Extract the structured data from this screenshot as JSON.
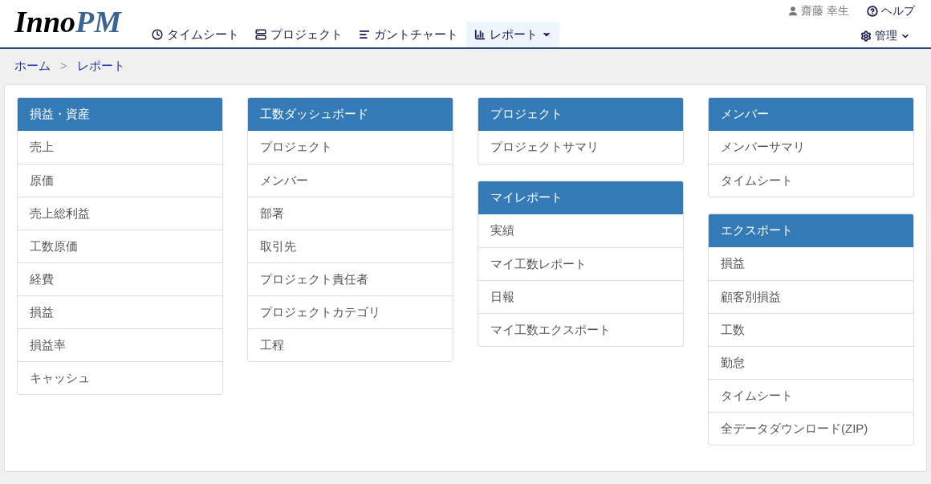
{
  "logo": {
    "first": "Inno",
    "second": "PM"
  },
  "nav": [
    {
      "label": "タイムシート",
      "kind": "link",
      "selected": false
    },
    {
      "label": "プロジェクト",
      "kind": "link",
      "selected": false
    },
    {
      "label": "ガントチャート",
      "kind": "link",
      "selected": false
    },
    {
      "label": "レポート",
      "kind": "dropdown",
      "selected": true
    }
  ],
  "user": {
    "name": "齋藤 幸生"
  },
  "help": {
    "label": "ヘルプ"
  },
  "admin": {
    "label": "管理"
  },
  "breadcrumb": [
    {
      "label": "ホーム"
    },
    {
      "label": "レポート"
    }
  ],
  "breadcrumb_separator": ">",
  "columns": [
    [
      {
        "title": "損益・資産",
        "items": [
          "売上",
          "原価",
          "売上総利益",
          "工数原価",
          "経費",
          "損益",
          "損益率",
          "キャッシュ"
        ]
      }
    ],
    [
      {
        "title": "工数ダッシュボード",
        "items": [
          "プロジェクト",
          "メンバー",
          "部署",
          "取引先",
          "プロジェクト責任者",
          "プロジェクトカテゴリ",
          "工程"
        ]
      }
    ],
    [
      {
        "title": "プロジェクト",
        "items": [
          "プロジェクトサマリ"
        ]
      },
      {
        "title": "マイレポート",
        "items": [
          "実績",
          "マイ工数レポート",
          "日報",
          "マイ工数エクスポート"
        ]
      }
    ],
    [
      {
        "title": "メンバー",
        "items": [
          "メンバーサマリ",
          "タイムシート"
        ]
      },
      {
        "title": "エクスポート",
        "items": [
          "損益",
          "顧客別損益",
          "工数",
          "勤怠",
          "タイムシート",
          "全データダウンロード(ZIP)"
        ]
      }
    ]
  ]
}
